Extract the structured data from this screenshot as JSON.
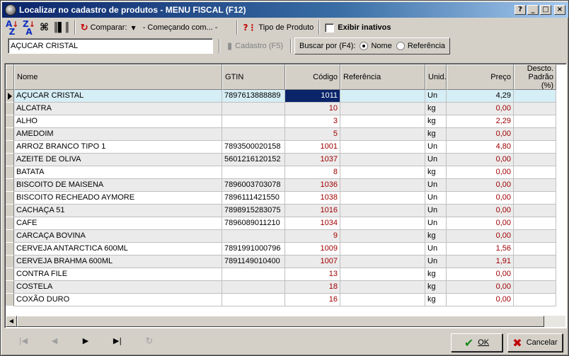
{
  "window": {
    "title": "Localizar no cadastro de produtos - MENU FISCAL (F12)",
    "controls": [
      "?",
      "_",
      "□",
      "×"
    ]
  },
  "toolbar": {
    "sort_asc_icon": "A↓Z",
    "sort_desc_icon": "Z↓A",
    "find_icon": "binoculars",
    "barcode_icon": "barcode",
    "compare_label": "Comparar:",
    "compare_value": "- Começando com... -",
    "tipo_produto_label": "Tipo de Produto",
    "exibir_inativos_label": "Exibir inativos"
  },
  "search": {
    "value": "AÇUCAR CRISTAL",
    "cadastro_label": "Cadastro (F5)",
    "buscar_por_label": "Buscar por (F4):",
    "options": [
      {
        "label": "Nome",
        "selected": true
      },
      {
        "label": "Referência",
        "selected": false
      }
    ]
  },
  "table": {
    "columns": [
      {
        "label": "Nome"
      },
      {
        "label": "GTIN"
      },
      {
        "label": "Código"
      },
      {
        "label": "Referência"
      },
      {
        "label": "Unid."
      },
      {
        "label": "Preço"
      },
      {
        "label": "Descto. Padrão (%)"
      }
    ],
    "rows": [
      {
        "nome": "AÇUCAR CRISTAL",
        "gtin": "7897613888889",
        "codigo": "1011",
        "referencia": "",
        "unid": "Un",
        "preco": "4,29",
        "descto": ""
      },
      {
        "nome": "ALCATRA",
        "gtin": "",
        "codigo": "10",
        "referencia": "",
        "unid": "kg",
        "preco": "0,00",
        "descto": ""
      },
      {
        "nome": "ALHO",
        "gtin": "",
        "codigo": "3",
        "referencia": "",
        "unid": "kg",
        "preco": "2,29",
        "descto": ""
      },
      {
        "nome": "AMEDOIM",
        "gtin": "",
        "codigo": "5",
        "referencia": "",
        "unid": "kg",
        "preco": "0,00",
        "descto": ""
      },
      {
        "nome": "ARROZ BRANCO TIPO 1",
        "gtin": "7893500020158",
        "codigo": "1001",
        "referencia": "",
        "unid": "Un",
        "preco": "4,80",
        "descto": ""
      },
      {
        "nome": "AZEITE DE OLIVA",
        "gtin": "5601216120152",
        "codigo": "1037",
        "referencia": "",
        "unid": "Un",
        "preco": "0,00",
        "descto": ""
      },
      {
        "nome": "BATATA",
        "gtin": "",
        "codigo": "8",
        "referencia": "",
        "unid": "kg",
        "preco": "0,00",
        "descto": ""
      },
      {
        "nome": "BISCOITO DE MAISENA",
        "gtin": "7896003703078",
        "codigo": "1036",
        "referencia": "",
        "unid": "Un",
        "preco": "0,00",
        "descto": ""
      },
      {
        "nome": "BISCOITO RECHEADO AYMORE",
        "gtin": "7896111421550",
        "codigo": "1038",
        "referencia": "",
        "unid": "Un",
        "preco": "0,00",
        "descto": ""
      },
      {
        "nome": "CACHAÇA 51",
        "gtin": "7898915283075",
        "codigo": "1016",
        "referencia": "",
        "unid": "Un",
        "preco": "0,00",
        "descto": ""
      },
      {
        "nome": "CAFE",
        "gtin": "7896089011210",
        "codigo": "1034",
        "referencia": "",
        "unid": "Un",
        "preco": "0,00",
        "descto": ""
      },
      {
        "nome": "CARCAÇA BOVINA",
        "gtin": "",
        "codigo": "9",
        "referencia": "",
        "unid": "kg",
        "preco": "0,00",
        "descto": ""
      },
      {
        "nome": "CERVEJA ANTARCTICA 600ML",
        "gtin": "7891991000796",
        "codigo": "1009",
        "referencia": "",
        "unid": "Un",
        "preco": "1,56",
        "descto": ""
      },
      {
        "nome": "CERVEJA BRAHMA 600ML",
        "gtin": "7891149010400",
        "codigo": "1007",
        "referencia": "",
        "unid": "Un",
        "preco": "1,91",
        "descto": ""
      },
      {
        "nome": "CONTRA FILE",
        "gtin": "",
        "codigo": "13",
        "referencia": "",
        "unid": "kg",
        "preco": "0,00",
        "descto": ""
      },
      {
        "nome": "COSTELA",
        "gtin": "",
        "codigo": "18",
        "referencia": "",
        "unid": "kg",
        "preco": "0,00",
        "descto": ""
      },
      {
        "nome": "COXÃO DURO",
        "gtin": "",
        "codigo": "16",
        "referencia": "",
        "unid": "kg",
        "preco": "0,00",
        "descto": ""
      }
    ]
  },
  "footer": {
    "nav_first": "|◀",
    "nav_prev": "◀",
    "nav_next": "▶",
    "nav_last": "▶|",
    "nav_refresh": "↻",
    "ok_label": "OK",
    "cancel_label": "Cancelar"
  },
  "colors": {
    "title_bar": "#0a246a",
    "selected_row": "#d6eef5",
    "code_red": "#a00000",
    "focus_cell": "#0a246a"
  }
}
